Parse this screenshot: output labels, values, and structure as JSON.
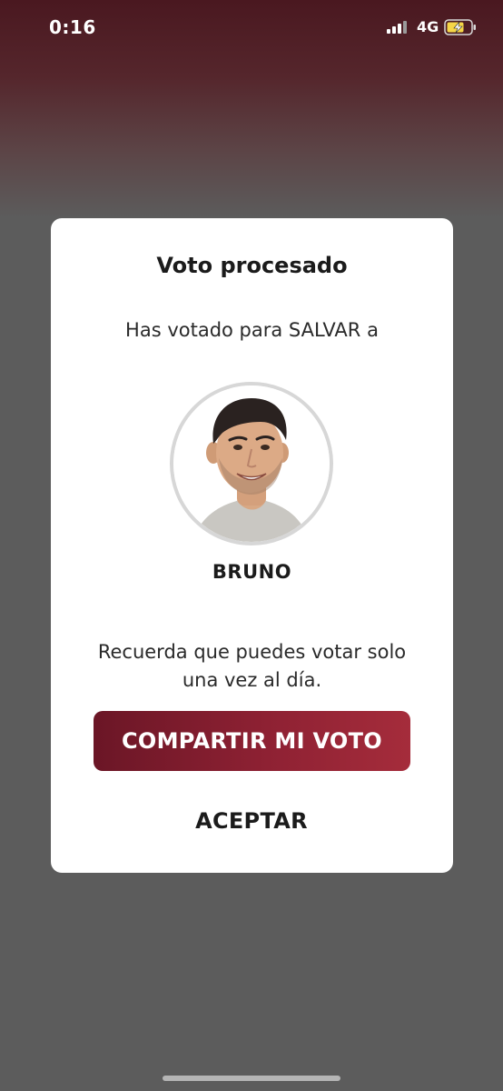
{
  "status_bar": {
    "time": "0:16",
    "network": "4G",
    "signal_icon": "signal-bars-icon",
    "battery_icon": "battery-charging-icon",
    "battery_color": "#f5d547"
  },
  "modal": {
    "title": "Voto procesado",
    "subtitle": "Has votado para SALVAR a",
    "candidate_name": "BRUNO",
    "reminder": "Recuerda que puedes votar solo una vez al día.",
    "share_button_label": "COMPARTIR MI VOTO",
    "accept_button_label": "ACEPTAR"
  },
  "colors": {
    "accent": "#8e2133",
    "accent_dark": "#6b1626",
    "overlay": "#5c5c5c"
  }
}
